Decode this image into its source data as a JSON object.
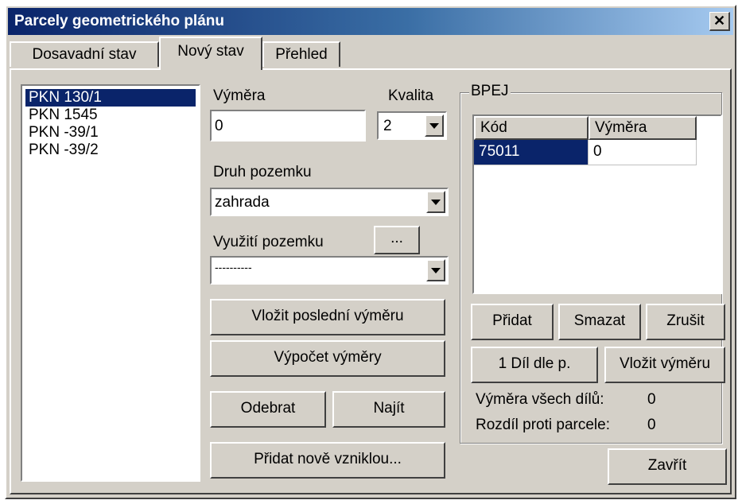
{
  "window": {
    "title": "Parcely geometrického plánu",
    "close_glyph": "✕"
  },
  "tabs": [
    {
      "label": "Dosavadní stav"
    },
    {
      "label": "Nový stav"
    },
    {
      "label": "Přehled"
    }
  ],
  "parcels": [
    "PKN 130/1",
    "PKN 1545",
    "PKN -39/1",
    "PKN -39/2"
  ],
  "form": {
    "vymera_label": "Výměra",
    "vymera_value": "0",
    "kvalita_label": "Kvalita",
    "kvalita_value": "2",
    "druh_label": "Druh pozemku",
    "druh_value": "zahrada",
    "vyuziti_label": "Využití pozemku",
    "vyuziti_button": "...",
    "vyuziti_value": "----------"
  },
  "buttons": {
    "vlozit_posledni": "Vložit poslední výměru",
    "vypocet": "Výpočet výměry",
    "odebrat": "Odebrat",
    "najit": "Najít",
    "pridat_nove": "Přidat nově vzniklou...",
    "zavrit": "Zavřít"
  },
  "bpej": {
    "legend": "BPEJ",
    "columns": [
      "Kód",
      "Výměra"
    ],
    "rows": [
      {
        "kod": "75011",
        "vymera": "0"
      }
    ],
    "pridat": "Přidat",
    "smazat": "Smazat",
    "zrusit": "Zrušit",
    "dil": "1 Díl dle p.",
    "vlozit_vymeru": "Vložit výměru",
    "vymera_vsech_label": "Výměra všech dílů:",
    "vymera_vsech_value": "0",
    "rozdil_label": "Rozdíl proti parcele:",
    "rozdil_value": "0"
  },
  "colors": {
    "face": "#d4d0c8",
    "selection": "#0a246a",
    "title_start": "#0a246a",
    "title_end": "#a6caf0"
  }
}
